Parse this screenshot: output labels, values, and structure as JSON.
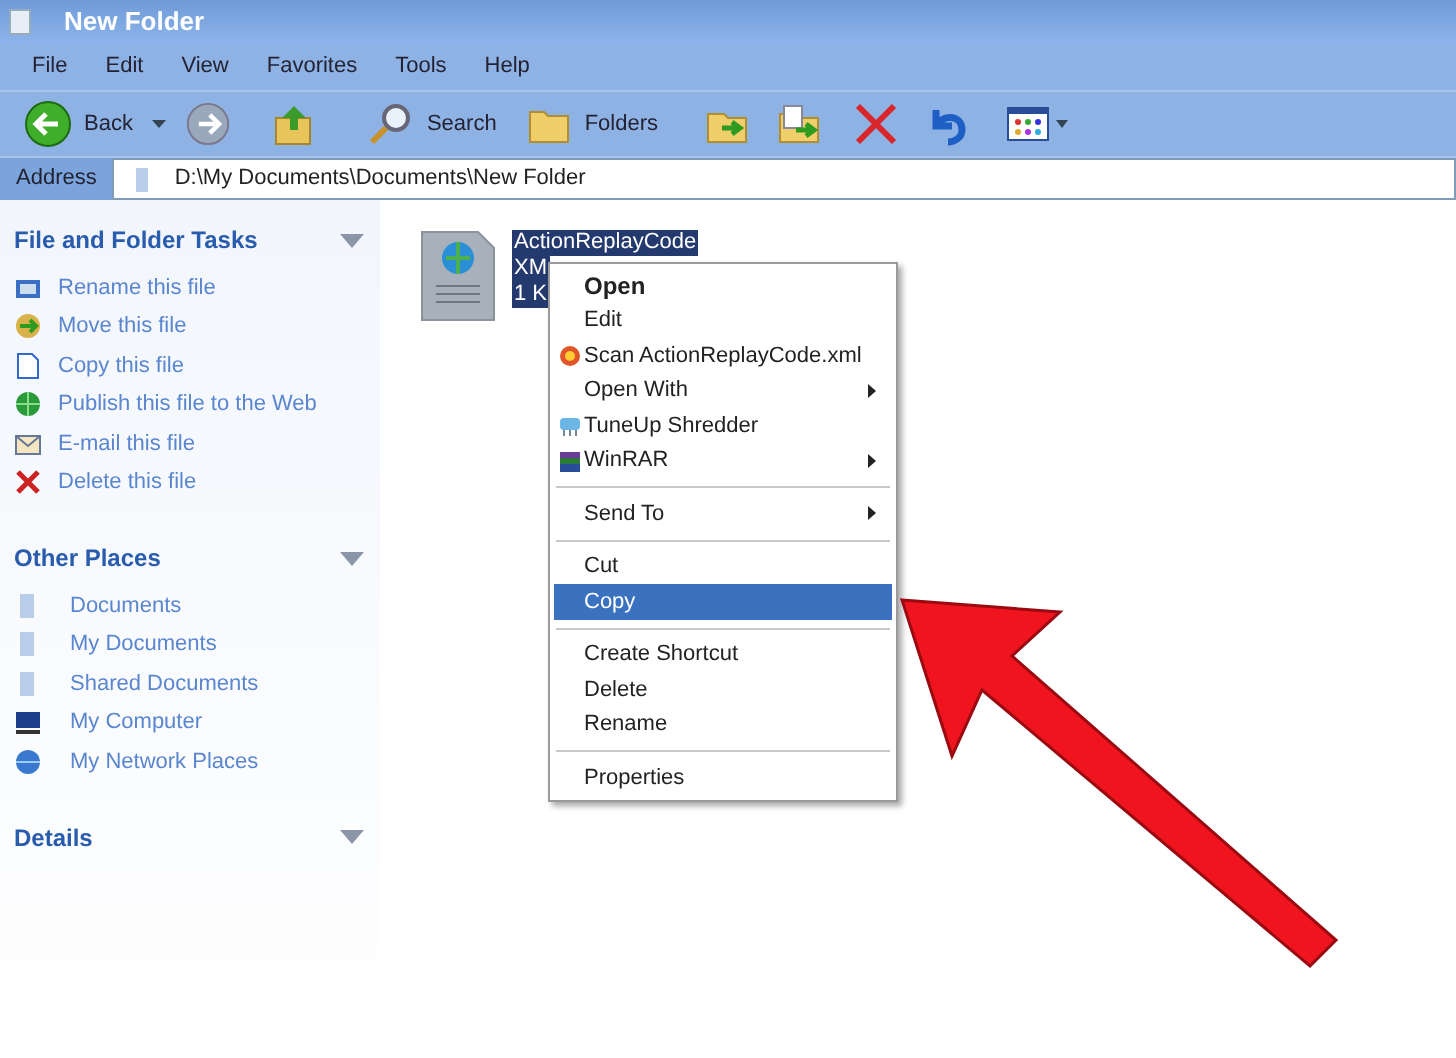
{
  "window": {
    "title": "New Folder"
  },
  "menu_bar": [
    "File",
    "Edit",
    "View",
    "Favorites",
    "Tools",
    "Help"
  ],
  "toolbar": {
    "back_label": "Back",
    "search_label": "Search",
    "folders_label": "Folders"
  },
  "address_bar": {
    "label": "Address",
    "value": "D:\\My Documents\\Documents\\New Folder"
  },
  "sidebar": [
    {
      "title": "File and Folder Tasks",
      "items": [
        "Rename this file",
        "Move this file",
        "Copy this file",
        "Publish this file to the Web",
        "E-mail this file",
        "Delete this file"
      ]
    },
    {
      "title": "Other Places",
      "items": [
        "Documents",
        "My Documents",
        "Shared Documents",
        "My Computer",
        "My Network Places"
      ]
    },
    {
      "title": "Details"
    }
  ],
  "file": {
    "name_lines": [
      "ActionReplayCode",
      "XM",
      "1 K"
    ],
    "selected": true
  },
  "context_menu": [
    {
      "kind": "item",
      "label": "Open",
      "default": true,
      "submenu": false,
      "selected": false
    },
    {
      "kind": "item",
      "label": "Edit",
      "default": false,
      "submenu": false,
      "selected": false
    },
    {
      "kind": "icon_item",
      "label": "Scan ActionReplayCode.xml",
      "default": false,
      "submenu": false,
      "selected": false
    },
    {
      "kind": "item",
      "label": "Open With",
      "default": false,
      "submenu": true,
      "selected": false
    },
    {
      "kind": "icon_item",
      "label": "TuneUp Shredder",
      "default": false,
      "submenu": false,
      "selected": false
    },
    {
      "kind": "icon_item",
      "label": "WinRAR",
      "default": false,
      "submenu": true,
      "selected": false
    },
    {
      "kind": "separator"
    },
    {
      "kind": "item",
      "label": "Send To",
      "default": false,
      "submenu": true,
      "selected": false
    },
    {
      "kind": "separator"
    },
    {
      "kind": "item",
      "label": "Cut",
      "default": false,
      "submenu": false,
      "selected": false
    },
    {
      "kind": "item",
      "label": "Copy",
      "default": false,
      "submenu": false,
      "selected": true
    },
    {
      "kind": "separator"
    },
    {
      "kind": "item",
      "label": "Create Shortcut",
      "default": false,
      "submenu": false,
      "selected": false
    },
    {
      "kind": "item",
      "label": "Delete",
      "default": false,
      "submenu": false,
      "selected": false
    },
    {
      "kind": "item",
      "label": "Rename",
      "default": false,
      "submenu": false,
      "selected": false
    },
    {
      "kind": "separator"
    },
    {
      "kind": "item",
      "label": "Properties",
      "default": false,
      "submenu": false,
      "selected": false
    }
  ]
}
